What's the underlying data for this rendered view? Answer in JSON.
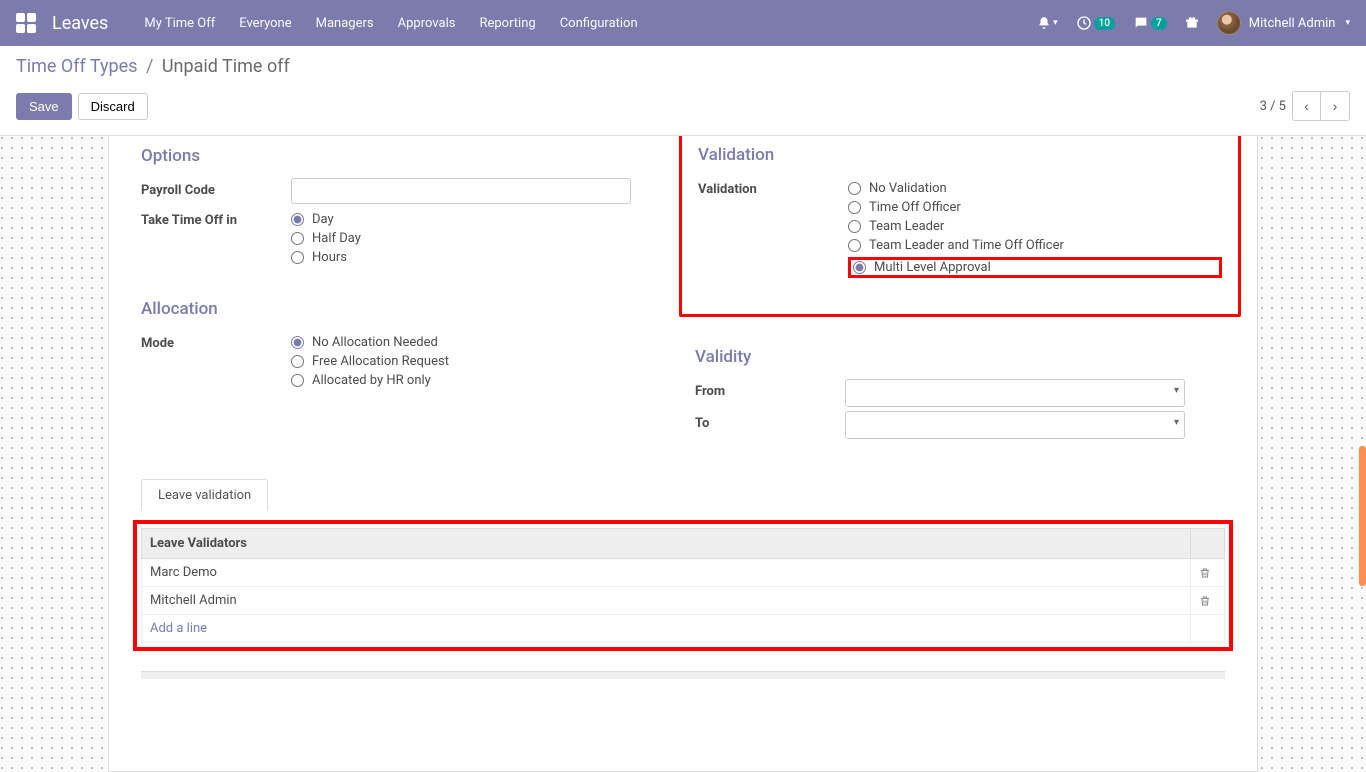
{
  "nav": {
    "brand": "Leaves",
    "links": [
      "My Time Off",
      "Everyone",
      "Managers",
      "Approvals",
      "Reporting",
      "Configuration"
    ],
    "activity_count": "10",
    "messages_count": "7",
    "user_name": "Mitchell Admin"
  },
  "breadcrumb": {
    "parent": "Time Off Types",
    "current": "Unpaid Time off"
  },
  "buttons": {
    "save": "Save",
    "discard": "Discard"
  },
  "pager": {
    "pos": "3 / 5"
  },
  "options": {
    "title": "Options",
    "payroll_label": "Payroll Code",
    "payroll_value": "",
    "takein_label": "Take Time Off in",
    "takein_opts": [
      "Day",
      "Half Day",
      "Hours"
    ],
    "takein_selected": 0
  },
  "validation": {
    "title": "Validation",
    "label": "Validation",
    "opts": [
      "No Validation",
      "Time Off Officer",
      "Team Leader",
      "Team Leader and Time Off Officer",
      "Multi Level Approval"
    ],
    "selected": 4
  },
  "allocation": {
    "title": "Allocation",
    "label": "Mode",
    "opts": [
      "No Allocation Needed",
      "Free Allocation Request",
      "Allocated by HR only"
    ],
    "selected": 0
  },
  "validity": {
    "title": "Validity",
    "from_label": "From",
    "to_label": "To",
    "from_value": "",
    "to_value": ""
  },
  "tabs": {
    "t0": "Leave validation"
  },
  "validators": {
    "header": "Leave Validators",
    "rows": [
      "Marc Demo",
      "Mitchell Admin"
    ],
    "add": "Add a line"
  }
}
